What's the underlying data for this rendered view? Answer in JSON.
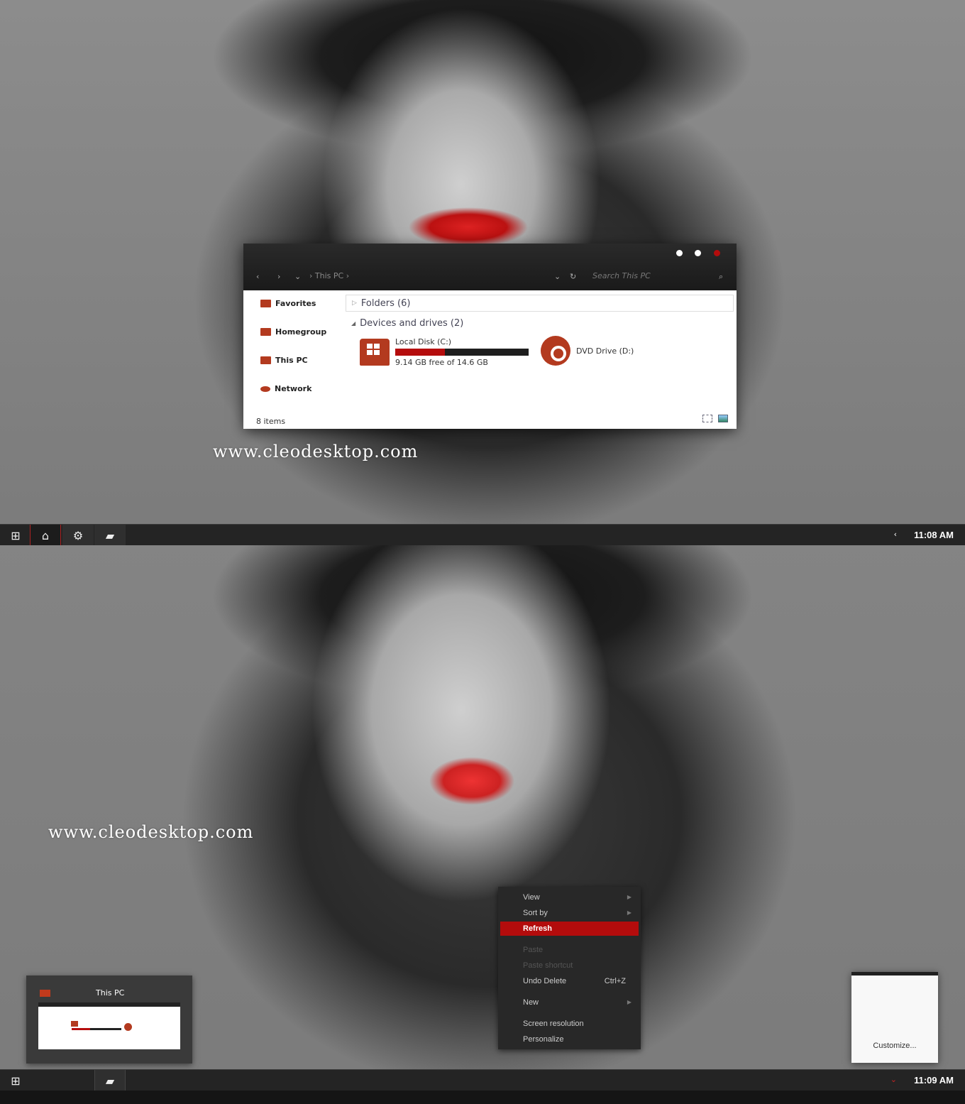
{
  "screen1": {
    "explorer": {
      "breadcrumb": "This PC",
      "search_placeholder": "Search This PC",
      "nav": {
        "back": "‹",
        "forward": "›",
        "recent": "⌄",
        "crumb_sep": "›",
        "dropdown": "⌄",
        "refresh": "↻",
        "search_icon": "⌕"
      },
      "sidebar": [
        {
          "label": "Favorites",
          "icon": "favorites-folder-icon"
        },
        {
          "label": "Homegroup",
          "icon": "homegroup-folder-icon"
        },
        {
          "label": "This PC",
          "icon": "monitor-icon"
        },
        {
          "label": "Network",
          "icon": "network-icon"
        }
      ],
      "groups": {
        "folders": "Folders (6)",
        "devices": "Devices and drives (2)"
      },
      "drives": [
        {
          "name": "Local Disk (C:)",
          "free_text": "9.14 GB free of 14.6 GB",
          "used_fraction": 0.374
        },
        {
          "name": "DVD Drive (D:)"
        }
      ],
      "status": "8 items"
    },
    "watermark": "www.cleodesktop.com",
    "taskbar": {
      "clock": "11:08 AM",
      "tray_chevron": "‹"
    }
  },
  "screen2": {
    "watermark": "www.cleodesktop.com",
    "context_menu": [
      {
        "label": "View",
        "submenu": true
      },
      {
        "label": "Sort by",
        "submenu": true
      },
      {
        "label": "Refresh",
        "highlighted": true
      },
      {
        "label": "Paste",
        "disabled": true
      },
      {
        "label": "Paste shortcut",
        "disabled": true
      },
      {
        "label": "Undo Delete",
        "shortcut": "Ctrl+Z"
      },
      {
        "label": "New",
        "submenu": true
      },
      {
        "label": "Screen resolution"
      },
      {
        "label": "Personalize"
      }
    ],
    "thumbnail": {
      "title": "This PC"
    },
    "tray_popup": {
      "link": "Customize..."
    },
    "taskbar": {
      "clock": "11:09 AM",
      "tray_chevron": "⌄"
    }
  },
  "colors": {
    "accent": "#b30c0c",
    "icon": "#b33a1f",
    "taskbar": "#242424"
  }
}
